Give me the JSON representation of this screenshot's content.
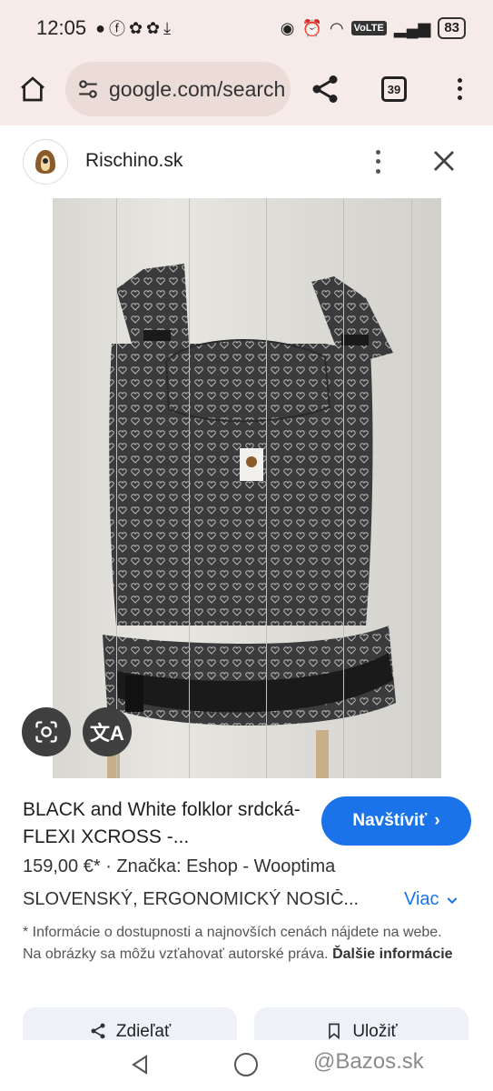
{
  "status_bar": {
    "time": "12:05",
    "volte": "VoLTE",
    "battery": "83"
  },
  "browser": {
    "url": "google.com/search",
    "tab_count": "39"
  },
  "source": {
    "site_name": "Rischino.sk"
  },
  "product": {
    "title": "BLACK and White folklor srdcká- FLEXI XCROSS -...",
    "visit_label": "Navštíviť",
    "price_line": "159,00 €*  ·  Značka: Eshop - Wooptima",
    "subtitle": "SLOVENSKÝ, ERGONOMICKÝ NOSIČ...",
    "more_label": "Viac",
    "notice": "* Informácie o dostupnosti a najnovších cenách nájdete na webe. Na obrázky sa môžu vzťahovať autorské práva.",
    "more_info_label": "Ďalšie informácie",
    "share_label": "Zdieľať",
    "save_label": "Uložiť"
  },
  "watermark": "@Bazos.sk",
  "icons": [
    "home-icon",
    "tune-icon",
    "share-icon",
    "tabs-icon",
    "more-vert-icon",
    "close-icon",
    "lens-icon",
    "translate-icon",
    "chevron-right-icon",
    "chevron-down-icon",
    "back-icon"
  ]
}
